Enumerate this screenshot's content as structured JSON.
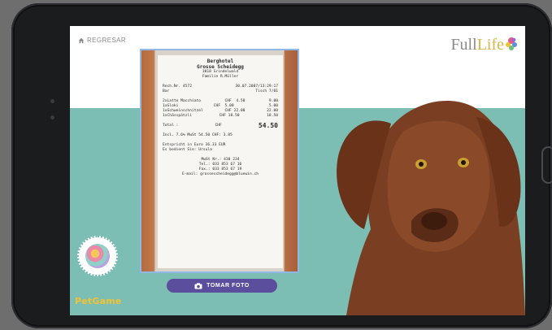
{
  "screen": {
    "back_label": "REGRESAR",
    "brand_full": "Full",
    "brand_life": "Life",
    "photo_button": "TOMAR FOTO",
    "petgame_label": "PetGame",
    "colors": {
      "teal": "#7dbeb4",
      "button": "#5b4e9c",
      "petgame": "#f1c232"
    }
  },
  "receipt": {
    "header1": "Berghotel",
    "header2": "Grosse Scheidegg",
    "header3": "3818 Grindelwald",
    "header4": "Familie R.Müller",
    "meta_left": "Rech.Nr. 4572",
    "meta_right": "30.07.2007/13:29:17",
    "meta2_left": "Bar",
    "meta2_right": "Tisch 7/01",
    "items": [
      {
        "text": "2xLatte Macchiato",
        "price": "CHF  4.50",
        "total": "9.00"
      },
      {
        "text": "1xGloki",
        "price": "CHF  5.00",
        "total": "5.00"
      },
      {
        "text": "1xSchweinschnitzel",
        "price": "CHF 22.00",
        "total": "22.00"
      },
      {
        "text": "1xChässpätzli",
        "price": "CHF 18.50",
        "total": "18.50"
      }
    ],
    "total_label": "Total :",
    "total_currency": "CHF",
    "total_value": "54.50",
    "vat_line": "Incl. 7.6% MwSt    54.50 CHF:     3.85",
    "euro_line": "Entspricht in Euro    36.33 EUR",
    "thanks": "Es bedient Sie: Ursula",
    "mwst_nr": "MwSt Nr.:  430 234",
    "tel": "Tel.:  033 853 67 16",
    "fax": "Fax.:  033 853 67 19",
    "email": "E-mail: grossescheidegg@bluewin.ch"
  }
}
